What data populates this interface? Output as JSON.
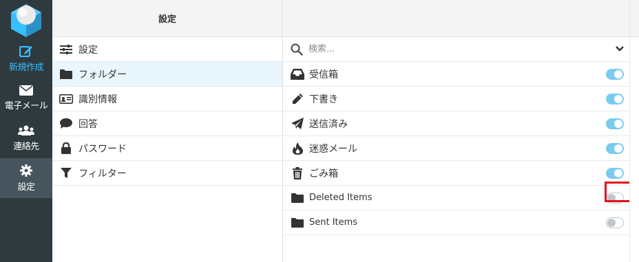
{
  "nav": {
    "compose": "新規作成",
    "mail": "電子メール",
    "contacts": "連絡先",
    "settings": "設定"
  },
  "settings_list": {
    "header": "設定",
    "items": [
      {
        "label": "設定",
        "icon": "sliders-icon"
      },
      {
        "label": "フォルダー",
        "icon": "folder-icon"
      },
      {
        "label": "識別情報",
        "icon": "id-card-icon"
      },
      {
        "label": "回答",
        "icon": "comment-icon"
      },
      {
        "label": "パスワード",
        "icon": "lock-icon"
      },
      {
        "label": "フィルター",
        "icon": "filter-icon"
      }
    ],
    "selected": "フォルダー"
  },
  "folders": {
    "search_placeholder": "検索...",
    "items": [
      {
        "label": "受信箱",
        "icon": "inbox-icon",
        "subscribed": true
      },
      {
        "label": "下書き",
        "icon": "pencil-icon",
        "subscribed": true
      },
      {
        "label": "送信済み",
        "icon": "paper-plane-icon",
        "subscribed": true
      },
      {
        "label": "迷惑メール",
        "icon": "fire-icon",
        "subscribed": true
      },
      {
        "label": "ごみ箱",
        "icon": "trash-icon",
        "subscribed": true
      },
      {
        "label": "Deleted Items",
        "icon": "folder-icon",
        "subscribed": false
      },
      {
        "label": "Sent Items",
        "icon": "folder-icon",
        "subscribed": false
      }
    ]
  },
  "colors": {
    "nav_bg": "#2f3a3f",
    "accent": "#37beff",
    "toggle_on": "#7bcbf0",
    "highlight": "#e3101d"
  }
}
